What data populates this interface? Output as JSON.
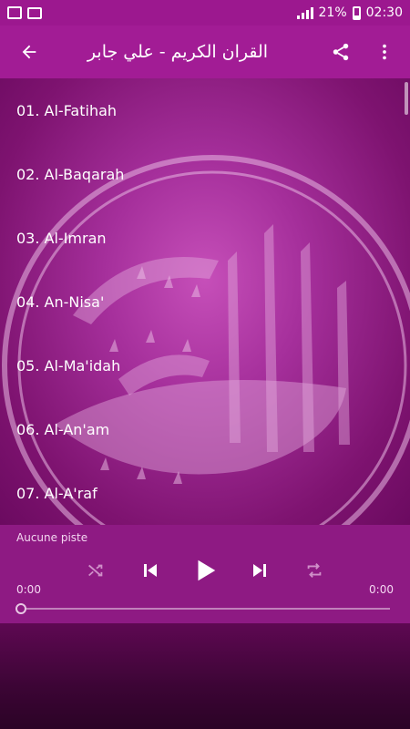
{
  "status_bar": {
    "battery": "21%",
    "time": "02:30"
  },
  "toolbar": {
    "title": "القران الكريم - علي جابر"
  },
  "tracks": [
    {
      "label": "01. Al-Fatihah"
    },
    {
      "label": "02. Al-Baqarah"
    },
    {
      "label": "03. Al-Imran"
    },
    {
      "label": "04. An-Nisa'"
    },
    {
      "label": "05. Al-Ma'idah"
    },
    {
      "label": "06. Al-An'am"
    },
    {
      "label": "07. Al-A'raf"
    }
  ],
  "player": {
    "now_playing": "Aucune piste",
    "time_elapsed": "0:00",
    "time_total": "0:00",
    "progress": 0
  },
  "colors": {
    "toolbar": "#a21c95",
    "status_bar": "#9c188f",
    "player": "#8e1a83"
  }
}
